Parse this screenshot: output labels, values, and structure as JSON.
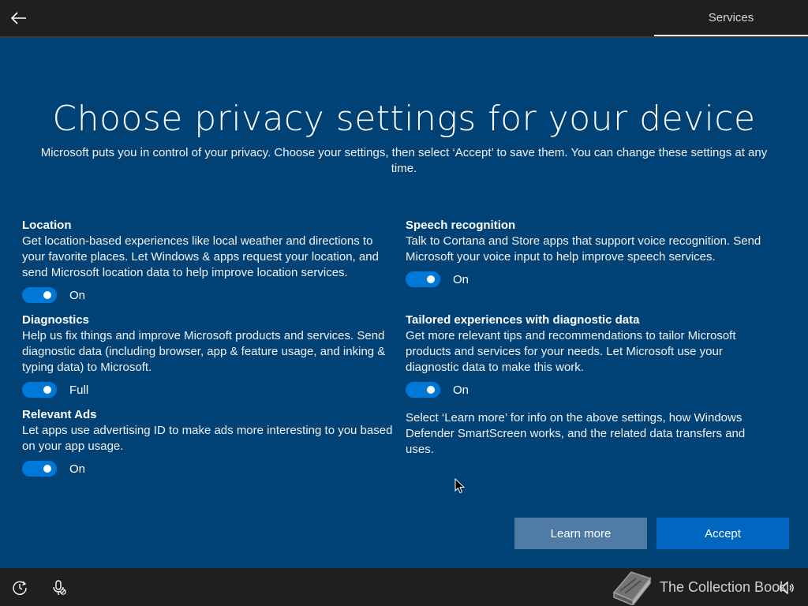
{
  "header": {
    "back_icon": "back-arrow-icon",
    "tab_label": "Services"
  },
  "main": {
    "title": "Choose privacy settings for your device",
    "subtitle": "Microsoft puts you in control of your privacy. Choose your settings, then select ‘Accept’ to save them. You can change these settings at any time."
  },
  "settings": {
    "location": {
      "title": "Location",
      "description": "Get location-based experiences like local weather and directions to your favorite places. Let Windows & apps request your location, and send Microsoft location data to help improve location services.",
      "state": "On"
    },
    "diagnostics": {
      "title": "Diagnostics",
      "description": "Help us fix things and improve Microsoft products and services. Send diagnostic data (including browser, app & feature usage, and inking & typing data) to Microsoft.",
      "state": "Full"
    },
    "relevant_ads": {
      "title": "Relevant Ads",
      "description": "Let apps use advertising ID to make ads more interesting to you based on your app usage.",
      "state": "On"
    },
    "speech": {
      "title": "Speech recognition",
      "description": "Talk to Cortana and Store apps that support voice recognition. Send Microsoft your voice input to help improve speech services.",
      "state": "On"
    },
    "tailored": {
      "title": "Tailored experiences with diagnostic data",
      "description": "Get more relevant tips and recommendations to tailor Microsoft products and services for your needs. Let Microsoft use your diagnostic data to make this work.",
      "state": "On"
    }
  },
  "note": "Select ‘Learn more’ for info on the above settings, how Windows Defender SmartScreen works, and the related data transfers and uses.",
  "buttons": {
    "learn_more": "Learn more",
    "accept": "Accept"
  },
  "footer": {
    "watermark": "The Collection Book",
    "icons": [
      "ease-of-access-icon",
      "microphone-icon",
      "volume-icon"
    ]
  },
  "colors": {
    "background": "#004275",
    "toggle_on": "#0078d7",
    "accept_button": "#0067c0",
    "learn_more_button": "#4f7ba4",
    "bar": "#1f1f1f"
  }
}
